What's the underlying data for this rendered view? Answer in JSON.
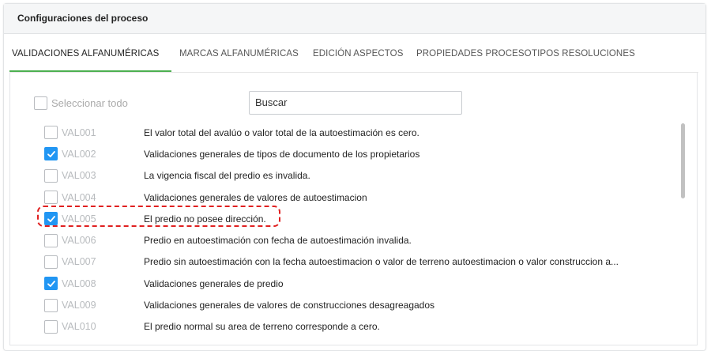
{
  "panel": {
    "title": "Configuraciones del proceso"
  },
  "tabs": [
    {
      "label": "VALIDACIONES ALFANUMÉRICAS",
      "active": true
    },
    {
      "label": "MARCAS ALFANUMÉRICAS",
      "active": false
    },
    {
      "label": "EDICIÓN ASPECTOS",
      "active": false
    },
    {
      "label": "PROPIEDADES PROCESO",
      "active": false
    },
    {
      "label": "TIPOS RESOLUCIONES",
      "active": false
    }
  ],
  "select_all": {
    "label": "Seleccionar todo",
    "checked": false
  },
  "search": {
    "value": "Buscar"
  },
  "validations": [
    {
      "code": "VAL001",
      "description": "El valor total del avalúo o valor total de la autoestimación es cero.",
      "checked": false
    },
    {
      "code": "VAL002",
      "description": "Validaciones generales de tipos de documento de los propietarios",
      "checked": true
    },
    {
      "code": "VAL003",
      "description": "La vigencia fiscal del predio es invalida.",
      "checked": false
    },
    {
      "code": "VAL004",
      "description": "Validaciones generales de valores de autoestimacion",
      "checked": false
    },
    {
      "code": "VAL005",
      "description": "El predio no posee dirección.",
      "checked": true
    },
    {
      "code": "VAL006",
      "description": "Predio en autoestimación con fecha de autoestimación invalida.",
      "checked": false
    },
    {
      "code": "VAL007",
      "description": "Predio sin autoestimación con la fecha autoestimacion o valor de terreno autoestimacion o valor construccion a...",
      "checked": false
    },
    {
      "code": "VAL008",
      "description": "Validaciones generales de predio",
      "checked": true
    },
    {
      "code": "VAL009",
      "description": "Validaciones generales de valores de construcciones desagreagados",
      "checked": false
    },
    {
      "code": "VAL010",
      "description": "El predio normal su area de terreno corresponde a cero.",
      "checked": false
    }
  ],
  "colors": {
    "accent_tab": "#4caf50",
    "checkbox_checked": "#2196f3",
    "highlight": "#e02020"
  }
}
